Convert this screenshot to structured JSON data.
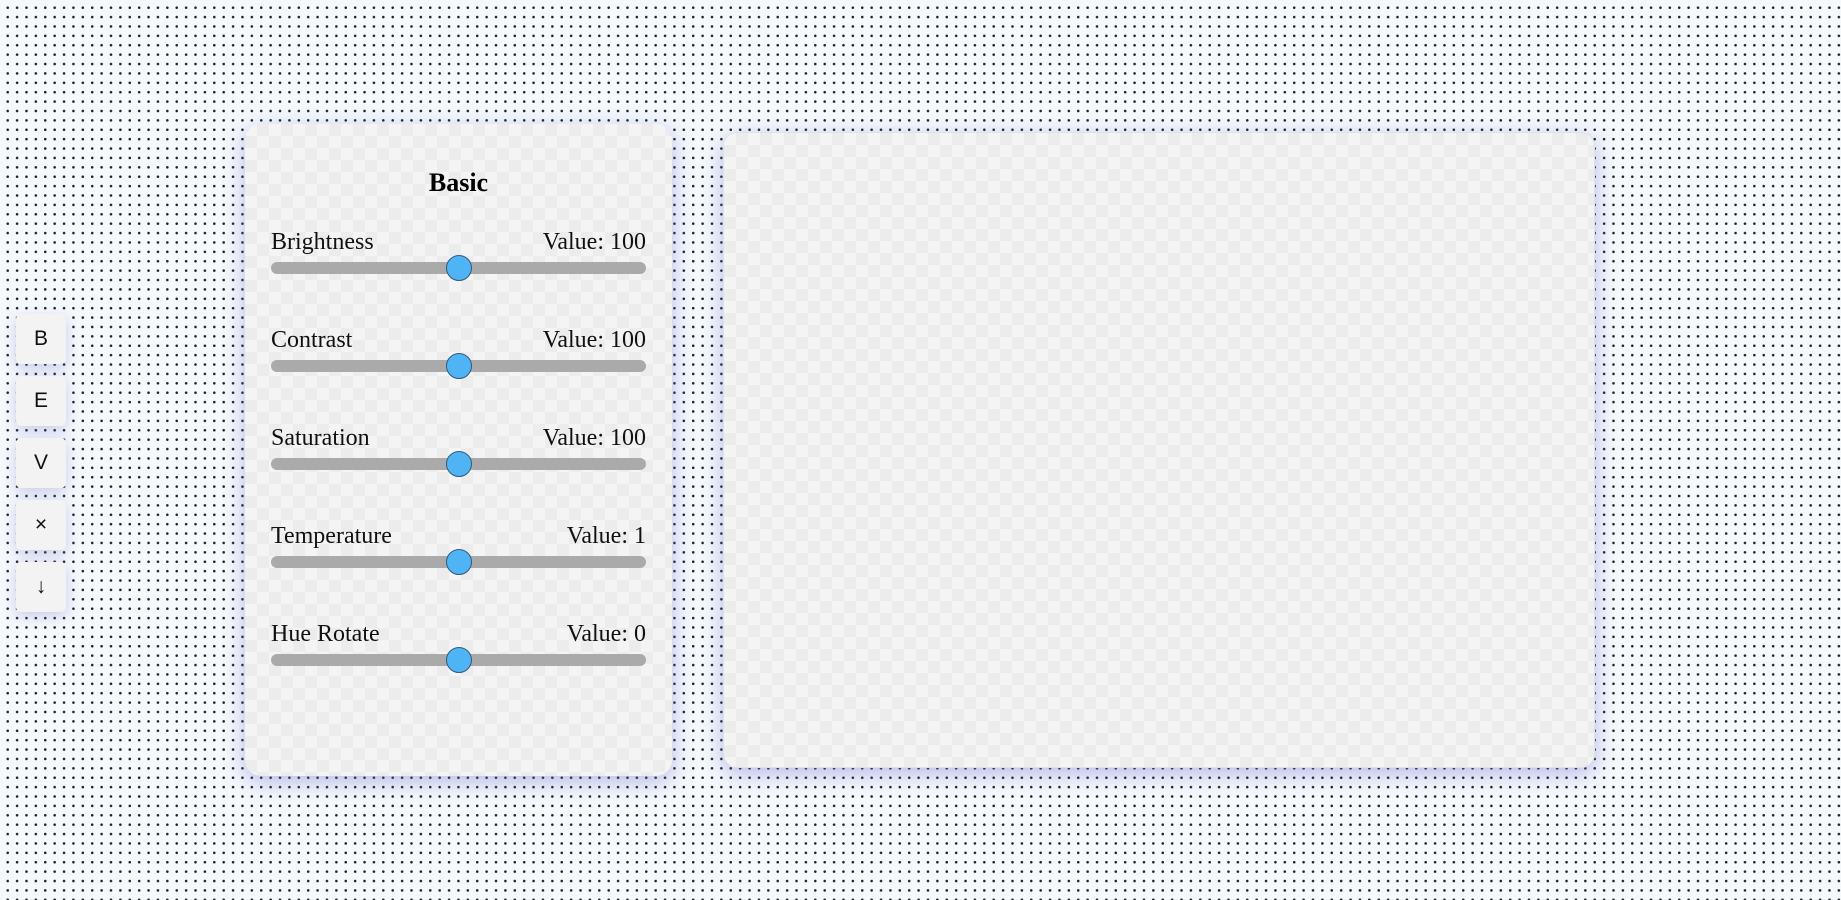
{
  "toolbar": {
    "buttons": [
      {
        "label": "B",
        "icon": "bold-letter-icon"
      },
      {
        "label": "E",
        "icon": "edit-letter-icon"
      },
      {
        "label": "V",
        "icon": "view-letter-icon"
      },
      {
        "label": "×",
        "icon": "close-icon"
      },
      {
        "label": "↓",
        "icon": "download-icon"
      }
    ]
  },
  "panel": {
    "title": "Basic",
    "value_prefix": "Value: ",
    "sliders": [
      {
        "label": "Brightness",
        "value": "100",
        "level": 0.5
      },
      {
        "label": "Contrast",
        "value": "100",
        "level": 0.5
      },
      {
        "label": "Saturation",
        "value": "100",
        "level": 0.5
      },
      {
        "label": "Temperature",
        "value": "1",
        "level": 0.5
      },
      {
        "label": "Hue Rotate",
        "value": "0",
        "level": 0.5
      }
    ]
  },
  "colors": {
    "accent": "#4fb4f5",
    "track": "#aaaaaa",
    "panel_shadow": "#6e6ed2"
  }
}
